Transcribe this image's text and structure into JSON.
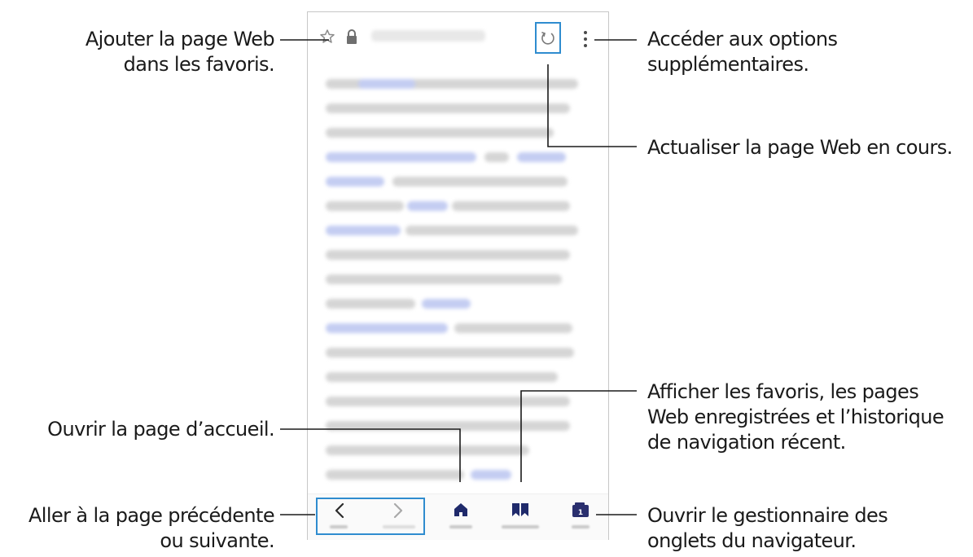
{
  "callouts": {
    "bookmark_add": [
      "Ajouter la page Web",
      "dans les favoris."
    ],
    "options": [
      "Accéder aux options",
      "supplémentaires."
    ],
    "refresh": [
      "Actualiser la page Web en cours."
    ],
    "bookmarks": [
      "Afficher les favoris, les pages",
      "Web enregistrées et l’historique",
      "de navigation récent."
    ],
    "home": [
      "Ouvrir la page d’accueil."
    ],
    "nav": [
      "Aller à la page précédente",
      "ou suivante."
    ],
    "tabs": [
      "Ouvrir le gestionnaire des",
      "onglets du navigateur."
    ]
  },
  "colors": {
    "accent_blue": "#2f8ccf",
    "icon_gray": "#3b3b3b",
    "icon_navy": "#1f2a6b"
  },
  "icons": {
    "urlbar": [
      "star-outline-icon",
      "lock-icon",
      "refresh-icon",
      "more-vertical-icon"
    ],
    "bottombar": [
      "chevron-left-icon",
      "chevron-right-icon",
      "home-icon",
      "bookmarks-icon",
      "tabs-icon"
    ]
  }
}
